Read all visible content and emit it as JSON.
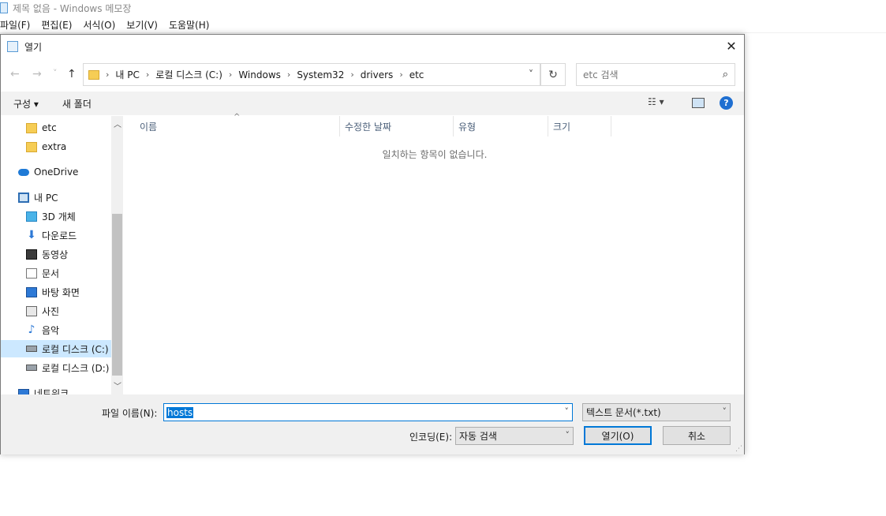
{
  "notepad": {
    "title": "제목 없음 - Windows 메모장",
    "menu": [
      "파일(F)",
      "편집(E)",
      "서식(O)",
      "보기(V)",
      "도움말(H)"
    ]
  },
  "dialog": {
    "title": "열기",
    "close_glyph": "✕",
    "nav": {
      "back": "←",
      "forward": "→",
      "recent": "˅",
      "up": "↑",
      "breadcrumbs": [
        "내 PC",
        "로컬 디스크 (C:)",
        "Windows",
        "System32",
        "drivers",
        "etc"
      ],
      "refresh_glyph": "↻",
      "search_placeholder": "etc 검색",
      "search_glyph": "⌕"
    },
    "toolbar": {
      "organize": "구성 ▾",
      "new_folder": "새 폴더",
      "view_glyph": "☷ ▾",
      "help_glyph": "?"
    },
    "navpane": {
      "items": [
        {
          "label": "etc",
          "icon": "folder-icon"
        },
        {
          "label": "extra",
          "icon": "folder-icon"
        },
        {
          "label": "OneDrive",
          "icon": "cloud-icon"
        },
        {
          "label": "내 PC",
          "icon": "pc-icon"
        },
        {
          "label": "3D 개체",
          "icon": "3d-objects-icon"
        },
        {
          "label": "다운로드",
          "icon": "download-icon"
        },
        {
          "label": "동영상",
          "icon": "video-icon"
        },
        {
          "label": "문서",
          "icon": "document-icon"
        },
        {
          "label": "바탕 화면",
          "icon": "desktop-icon"
        },
        {
          "label": "사진",
          "icon": "pictures-icon"
        },
        {
          "label": "음악",
          "icon": "music-icon"
        },
        {
          "label": "로컬 디스크 (C:)",
          "icon": "drive-icon"
        },
        {
          "label": "로컬 디스크 (D:)",
          "icon": "drive-icon"
        },
        {
          "label": "네트워크",
          "icon": "network-icon"
        }
      ]
    },
    "columns": [
      "이름",
      "수정한 날짜",
      "유형",
      "크기"
    ],
    "empty_message": "일치하는 항목이 없습니다.",
    "bottom": {
      "filename_label": "파일 이름(N):",
      "filename_value": "hosts",
      "filetype_value": "텍스트 문서(*.txt)",
      "encoding_label": "인코딩(E):",
      "encoding_value": "자동 검색",
      "open_button": "열기(O)",
      "cancel_button": "취소"
    }
  },
  "colors": {
    "accent": "#0078d7",
    "selection": "#cce8ff",
    "toolbar_bg": "#f2f2f2"
  }
}
